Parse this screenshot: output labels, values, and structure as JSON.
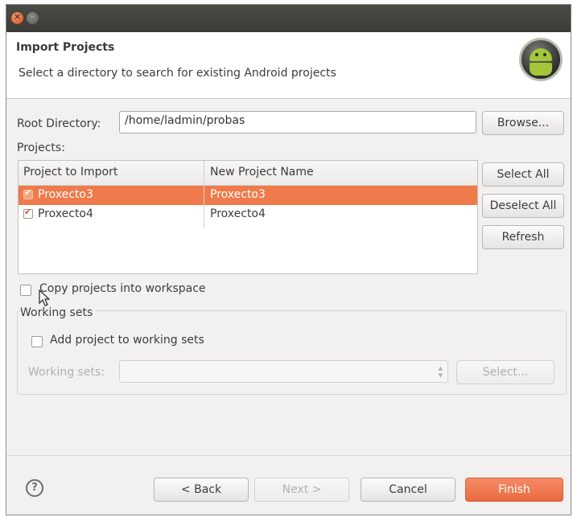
{
  "titlebar": {
    "close_icon": "close-icon",
    "minimize_icon": "minimize-icon"
  },
  "header": {
    "title": "Import Projects",
    "subtitle": "Select a directory to search for existing Android projects",
    "logo": "android-logo"
  },
  "root_directory": {
    "label": "Root Directory:",
    "value": "/home/ladmin/probas",
    "browse_label": "Browse..."
  },
  "projects": {
    "label": "Projects:",
    "columns": [
      "Project to Import",
      "New Project Name"
    ],
    "rows": [
      {
        "project": "Proxecto3",
        "new_name": "Proxecto3",
        "checked": true,
        "selected": true
      },
      {
        "project": "Proxecto4",
        "new_name": "Proxecto4",
        "checked": true,
        "selected": false
      }
    ],
    "select_all": "Select All",
    "deselect_all": "Deselect All",
    "refresh": "Refresh"
  },
  "copy_projects": {
    "label": "Copy projects into workspace",
    "checked": false
  },
  "working_sets": {
    "group_label": "Working sets",
    "add_label": "Add project to working sets",
    "add_checked": false,
    "sets_label": "Working sets:",
    "sets_value": "",
    "select_label": "Select..."
  },
  "footer": {
    "help_icon": "help-icon",
    "help_glyph": "?",
    "back": "< Back",
    "next": "Next >",
    "cancel": "Cancel",
    "finish": "Finish"
  },
  "colors": {
    "accent": "#ef7a4c",
    "finish": "#ea6a3f",
    "titlebar": "#3c3b37"
  }
}
